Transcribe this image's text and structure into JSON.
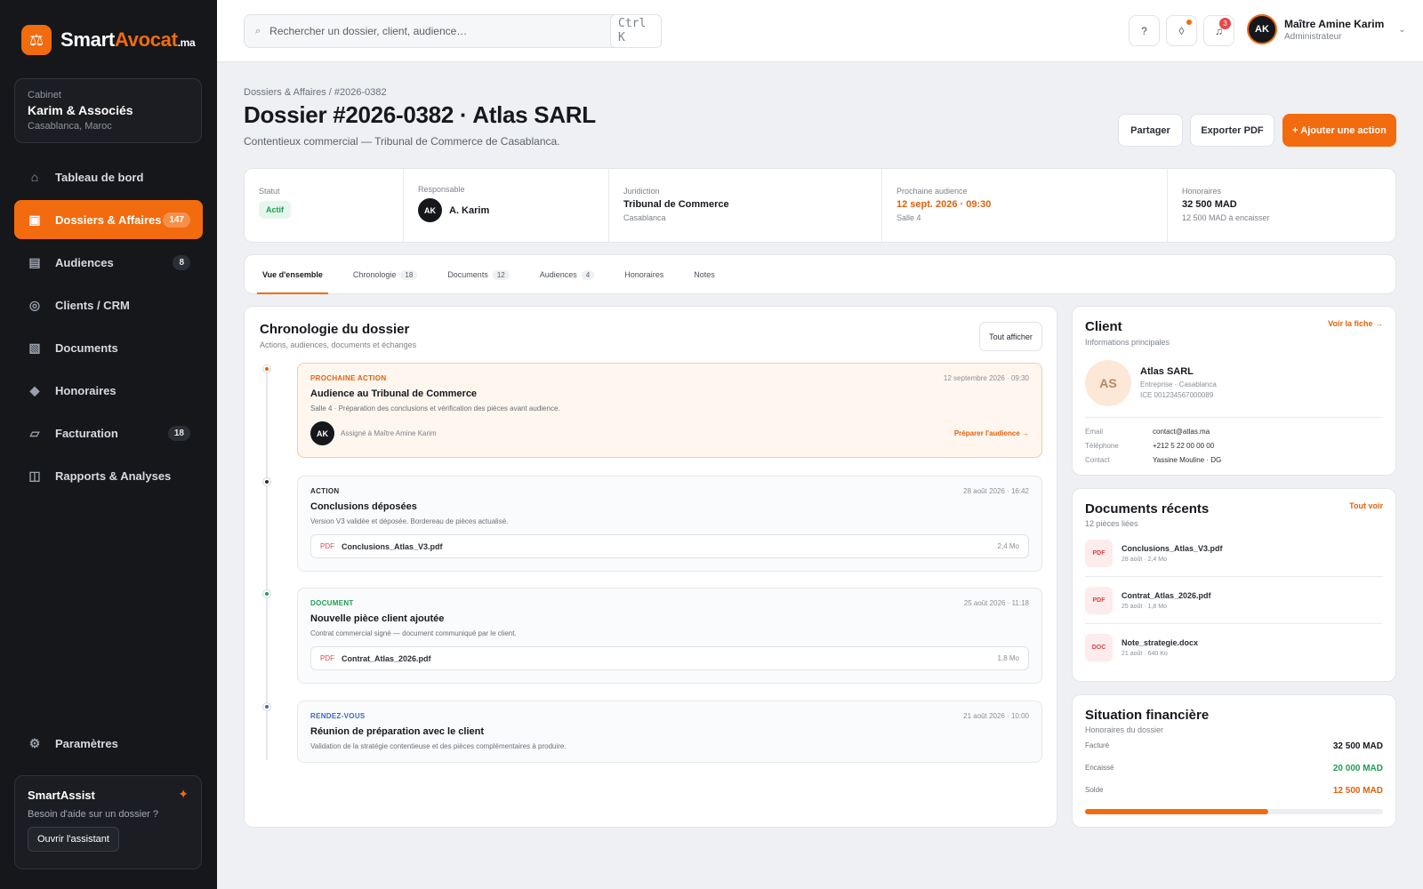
{
  "brand": {
    "name_a": "Smart",
    "name_b": "Avocat",
    "name_c": ".ma",
    "logo_icon": "balance-scale-icon"
  },
  "cabinet": {
    "label": "Cabinet",
    "name": "Karim & Associés",
    "location": "Casablanca, Maroc"
  },
  "nav": [
    {
      "label": "Tableau de bord",
      "icon": "⌂",
      "badge": ""
    },
    {
      "label": "Dossiers & Affaires",
      "icon": "▣",
      "badge": "147"
    },
    {
      "label": "Audiences",
      "icon": "▤",
      "badge": "8"
    },
    {
      "label": "Clients / CRM",
      "icon": "◎",
      "badge": ""
    },
    {
      "label": "Documents",
      "icon": "▧",
      "badge": ""
    },
    {
      "label": "Honoraires",
      "icon": "◆",
      "badge": ""
    },
    {
      "label": "Facturation",
      "icon": "▱",
      "badge": "18"
    },
    {
      "label": "Rapports & Analyses",
      "icon": "◫",
      "badge": ""
    }
  ],
  "settings": {
    "label": "Paramètres",
    "icon": "⚙"
  },
  "assistant": {
    "title": "SmartAssist",
    "subtitle": "Besoin d'aide sur un dossier ?",
    "button": "Ouvrir l'assistant",
    "icon": "✦"
  },
  "topbar": {
    "search_placeholder": "Rechercher un dossier, client, audience…",
    "search_icon": "⌕",
    "shortcut": "Ctrl K",
    "help_icon": "?",
    "mail_icon": "◊",
    "bell_icon": "♫",
    "notif_count": "3",
    "user_initials": "AK",
    "user_name": "Maître Amine Karim",
    "user_role": "Administrateur",
    "chevron": "⌄"
  },
  "page": {
    "breadcrumb": "Dossiers & Affaires / #2026-0382",
    "title": "Dossier #2026-0382 · Atlas SARL",
    "subtitle": "Contentieux commercial — Tribunal de Commerce de Casablanca.",
    "btn_share": "Partager",
    "btn_export": "Exporter PDF",
    "btn_add": "+ Ajouter une action"
  },
  "summary": {
    "status_label": "Statut",
    "status_value": "Actif",
    "resp_label": "Responsable",
    "resp_initials": "AK",
    "resp_name": "A. Karim",
    "jur_label": "Juridiction",
    "jur_value": "Tribunal de Commerce",
    "jur_sub": "Casablanca",
    "hearing_label": "Prochaine audience",
    "hearing_value": "12 sept. 2026 · 09:30",
    "hearing_sub": "Salle 4",
    "fees_label": "Honoraires",
    "fees_value": "32 500 MAD",
    "fees_sub": "12 500 MAD à encaisser"
  },
  "tabs": [
    {
      "label": "Vue d'ensemble",
      "count": ""
    },
    {
      "label": "Chronologie",
      "count": "18"
    },
    {
      "label": "Documents",
      "count": "12"
    },
    {
      "label": "Audiences",
      "count": "4"
    },
    {
      "label": "Honoraires",
      "count": ""
    },
    {
      "label": "Notes",
      "count": ""
    }
  ],
  "timeline": {
    "title": "Chronologie du dossier",
    "subtitle": "Actions, audiences, documents et échanges",
    "show_all": "Tout afficher",
    "items": [
      {
        "type": "PROCHAINE ACTION",
        "date": "12 septembre 2026 · 09:30",
        "title": "Audience au Tribunal de Commerce",
        "desc": "Salle 4 · Préparation des conclusions et vérification des pièces avant audience.",
        "assignee_initials": "AK",
        "assignee": "Assigné à Maître Amine Karim",
        "link": "Préparer l'audience →",
        "color": "#e0620c"
      },
      {
        "type": "ACTION",
        "date": "28 août 2026 · 16:42",
        "title": "Conclusions déposées",
        "desc": "Version V3 validée et déposée. Bordereau de pièces actualisé.",
        "file_type": "PDF",
        "file_name": "Conclusions_Atlas_V3.pdf",
        "file_size": "2,4 Mo",
        "color": "#2a2e35"
      },
      {
        "type": "DOCUMENT",
        "date": "25 août 2026 · 11:18",
        "title": "Nouvelle pièce client ajoutée",
        "desc": "Contrat commercial signé — document communiqué par le client.",
        "file_type": "PDF",
        "file_name": "Contrat_Atlas_2026.pdf",
        "file_size": "1,8 Mo",
        "color": "#1f9d55"
      },
      {
        "type": "RENDEZ-VOUS",
        "date": "21 août 2026 · 10:00",
        "title": "Réunion de préparation avec le client",
        "desc": "Validation de la stratégie contentieuse et des pièces complémentaires à produire.",
        "color": "#3b6bb5"
      }
    ]
  },
  "client": {
    "title": "Client",
    "subtitle": "Informations principales",
    "link": "Voir la fiche →",
    "initials": "AS",
    "name": "Atlas SARL",
    "line1": "Entreprise · Casablanca",
    "line2": "ICE 001234567000089",
    "email_k": "Email",
    "email_v": "contact@atlas.ma",
    "phone_k": "Téléphone",
    "phone_v": "+212 5 22 00 00 00",
    "contact_k": "Contact",
    "contact_v": "Yassine Mouline · DG"
  },
  "documents": {
    "title": "Documents récents",
    "subtitle": "12 pièces liées",
    "link": "Tout voir",
    "items": [
      {
        "type": "PDF",
        "name": "Conclusions_Atlas_V3.pdf",
        "meta": "28 août · 2,4 Mo"
      },
      {
        "type": "PDF",
        "name": "Contrat_Atlas_2026.pdf",
        "meta": "25 août · 1,8 Mo"
      },
      {
        "type": "DOC",
        "name": "Note_strategie.docx",
        "meta": "21 août · 640 Ko"
      }
    ]
  },
  "finance": {
    "title": "Situation financière",
    "subtitle": "Honoraires du dossier",
    "billed_k": "Facturé",
    "billed_v": "32 500 MAD",
    "paid_k": "Encaissé",
    "paid_v": "20 000 MAD",
    "balance_k": "Solde",
    "balance_v": "12 500 MAD",
    "progress": 0.615,
    "accent": "#f26b0f",
    "paid_color": "#1f9d55"
  }
}
